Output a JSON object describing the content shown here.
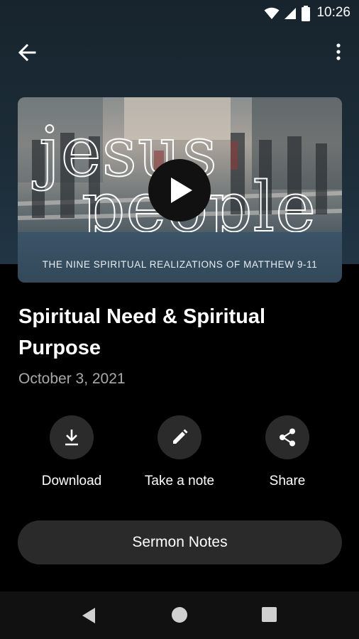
{
  "status_bar": {
    "time": "10:26"
  },
  "video": {
    "art_line1": "jesus",
    "art_line2": "people",
    "subtitle": "THE NINE SPIRITUAL REALIZATIONS OF MATTHEW 9-11"
  },
  "sermon": {
    "title": "Spiritual Need & Spiritual Purpose",
    "date": "October 3, 2021"
  },
  "actions": {
    "download": "Download",
    "note": "Take a note",
    "share": "Share"
  },
  "sermon_notes_button": "Sermon Notes",
  "colors": {
    "header_bg": "#1c2c37",
    "button_bg": "#2b2b2b",
    "date_text": "#a9a9a9"
  }
}
